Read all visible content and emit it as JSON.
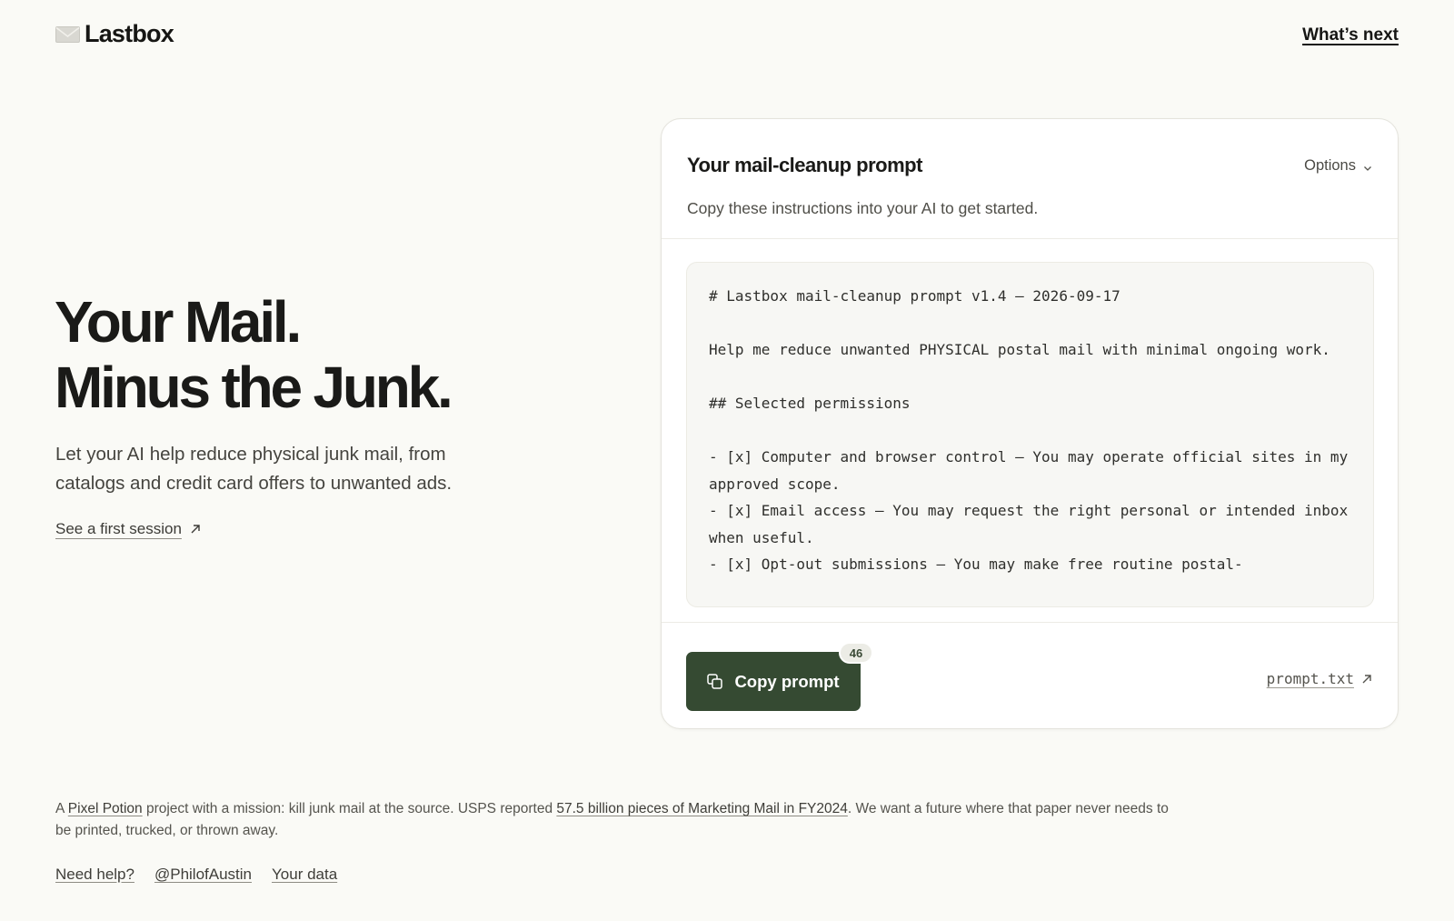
{
  "header": {
    "logo_icon": "envelope-icon",
    "logo_text": "Lastbox",
    "nav_link": "What’s next"
  },
  "hero": {
    "title_line1": "Your Mail.",
    "title_line2": "Minus the Junk.",
    "subtitle": "Let your AI help reduce physical junk mail, from catalogs and credit card offers to unwanted ads.",
    "session_link": "See a first session",
    "session_link_icon": "arrow-up-right-icon"
  },
  "prompt_card": {
    "title": "Your mail-cleanup prompt",
    "options_label": "Options",
    "options_icon": "chevron-down-icon",
    "description": "Copy these instructions into your AI to get started.",
    "code": "# Lastbox mail-cleanup prompt v1.4 — 2026-09-17\n\nHelp me reduce unwanted PHYSICAL postal mail with minimal ongoing work.\n\n## Selected permissions\n\n- [x] Computer and browser control — You may operate official sites in my approved scope.\n- [x] Email access — You may request the right personal or intended inbox when useful.\n- [x] Opt-out submissions — You may make free routine postal-",
    "copy_button_label": "Copy prompt",
    "copy_icon": "copy-icon",
    "copy_count": "46",
    "file_link": "prompt.txt",
    "file_link_icon": "arrow-up-right-icon"
  },
  "footer": {
    "note_prefix": "A ",
    "note_link1": "Pixel Potion",
    "note_mid": " project with a mission: kill junk mail at the source. USPS reported ",
    "note_link2": "57.5 billion pieces of Marketing Mail in FY2024",
    "note_suffix": ". We want a future where that paper never needs to be printed, trucked, or thrown away.",
    "links": [
      "Need help?",
      "@PhilofAustin",
      "Your data"
    ]
  },
  "colors": {
    "background": "#fafaf6",
    "button": "#354a32",
    "text": "#1c1c1a"
  }
}
